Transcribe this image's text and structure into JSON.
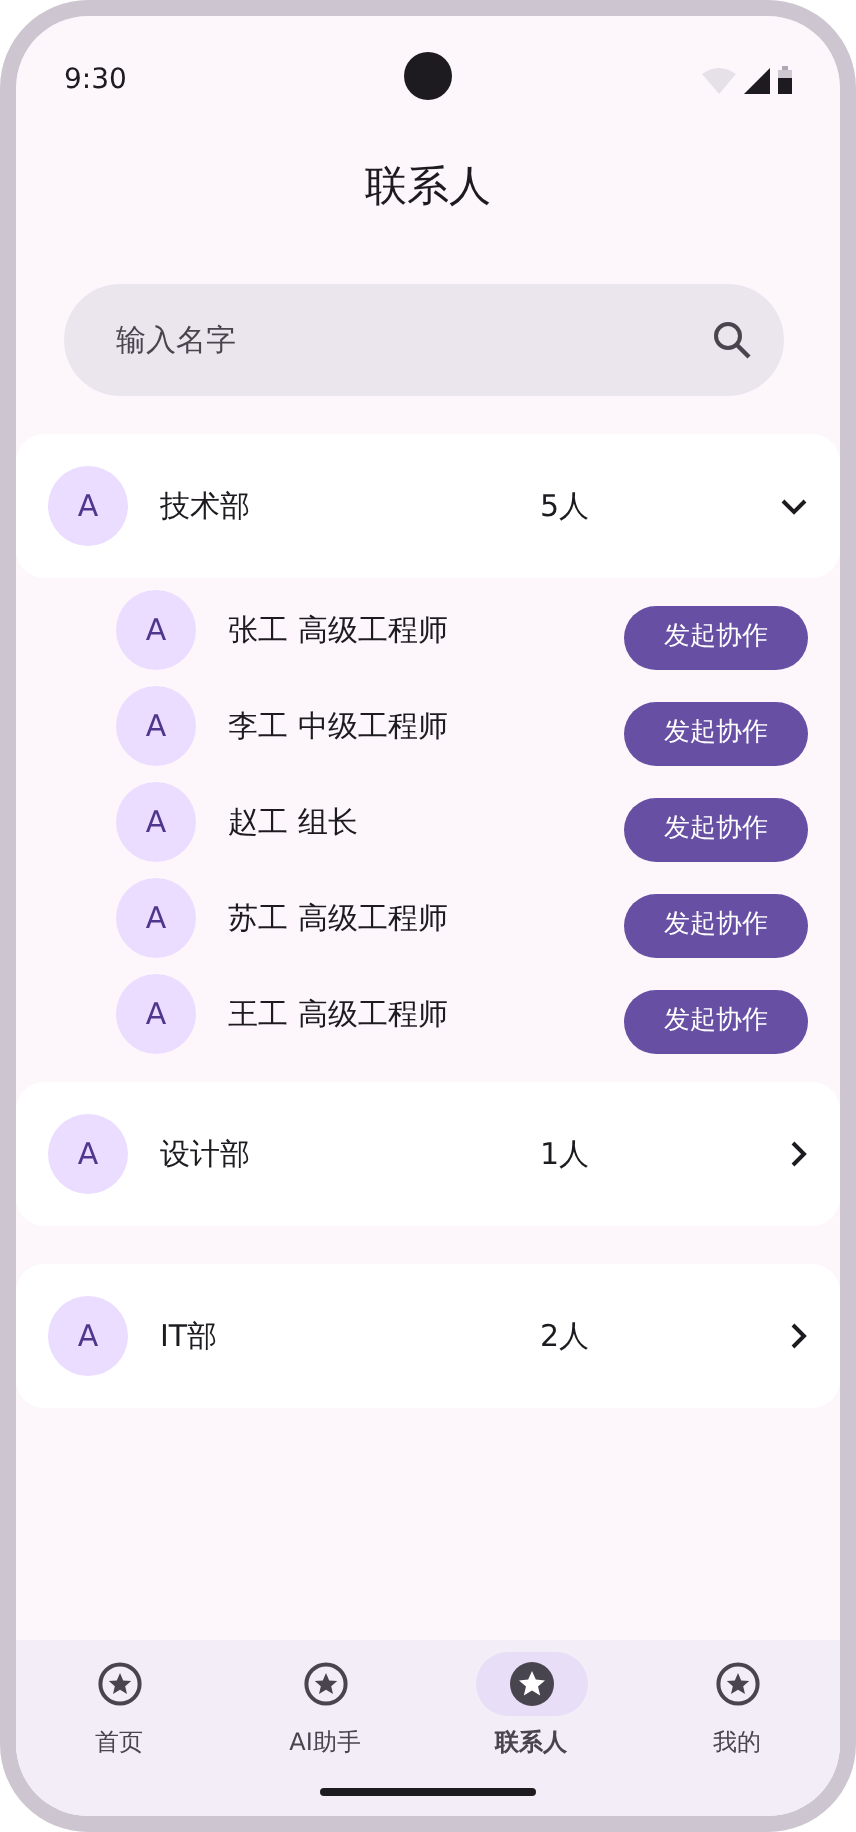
{
  "status_bar": {
    "time": "9:30"
  },
  "title": "联系人",
  "search": {
    "placeholder": "输入名字"
  },
  "groups": [
    {
      "avatar": "A",
      "name": "技术部",
      "count": "5人",
      "expanded": true,
      "members": [
        {
          "avatar": "A",
          "name": "张工 高级工程师",
          "action": "发起协作"
        },
        {
          "avatar": "A",
          "name": "李工 中级工程师",
          "action": "发起协作"
        },
        {
          "avatar": "A",
          "name": "赵工 组长",
          "action": "发起协作"
        },
        {
          "avatar": "A",
          "name": "苏工 高级工程师",
          "action": "发起协作"
        },
        {
          "avatar": "A",
          "name": "王工 高级工程师",
          "action": "发起协作"
        }
      ]
    },
    {
      "avatar": "A",
      "name": "设计部",
      "count": "1人",
      "expanded": false
    },
    {
      "avatar": "A",
      "name": "IT部",
      "count": "2人",
      "expanded": false
    }
  ],
  "bottom_nav": [
    {
      "label": "首页",
      "selected": false
    },
    {
      "label": "AI助手",
      "selected": false
    },
    {
      "label": "联系人",
      "selected": true
    },
    {
      "label": "我的",
      "selected": false
    }
  ]
}
